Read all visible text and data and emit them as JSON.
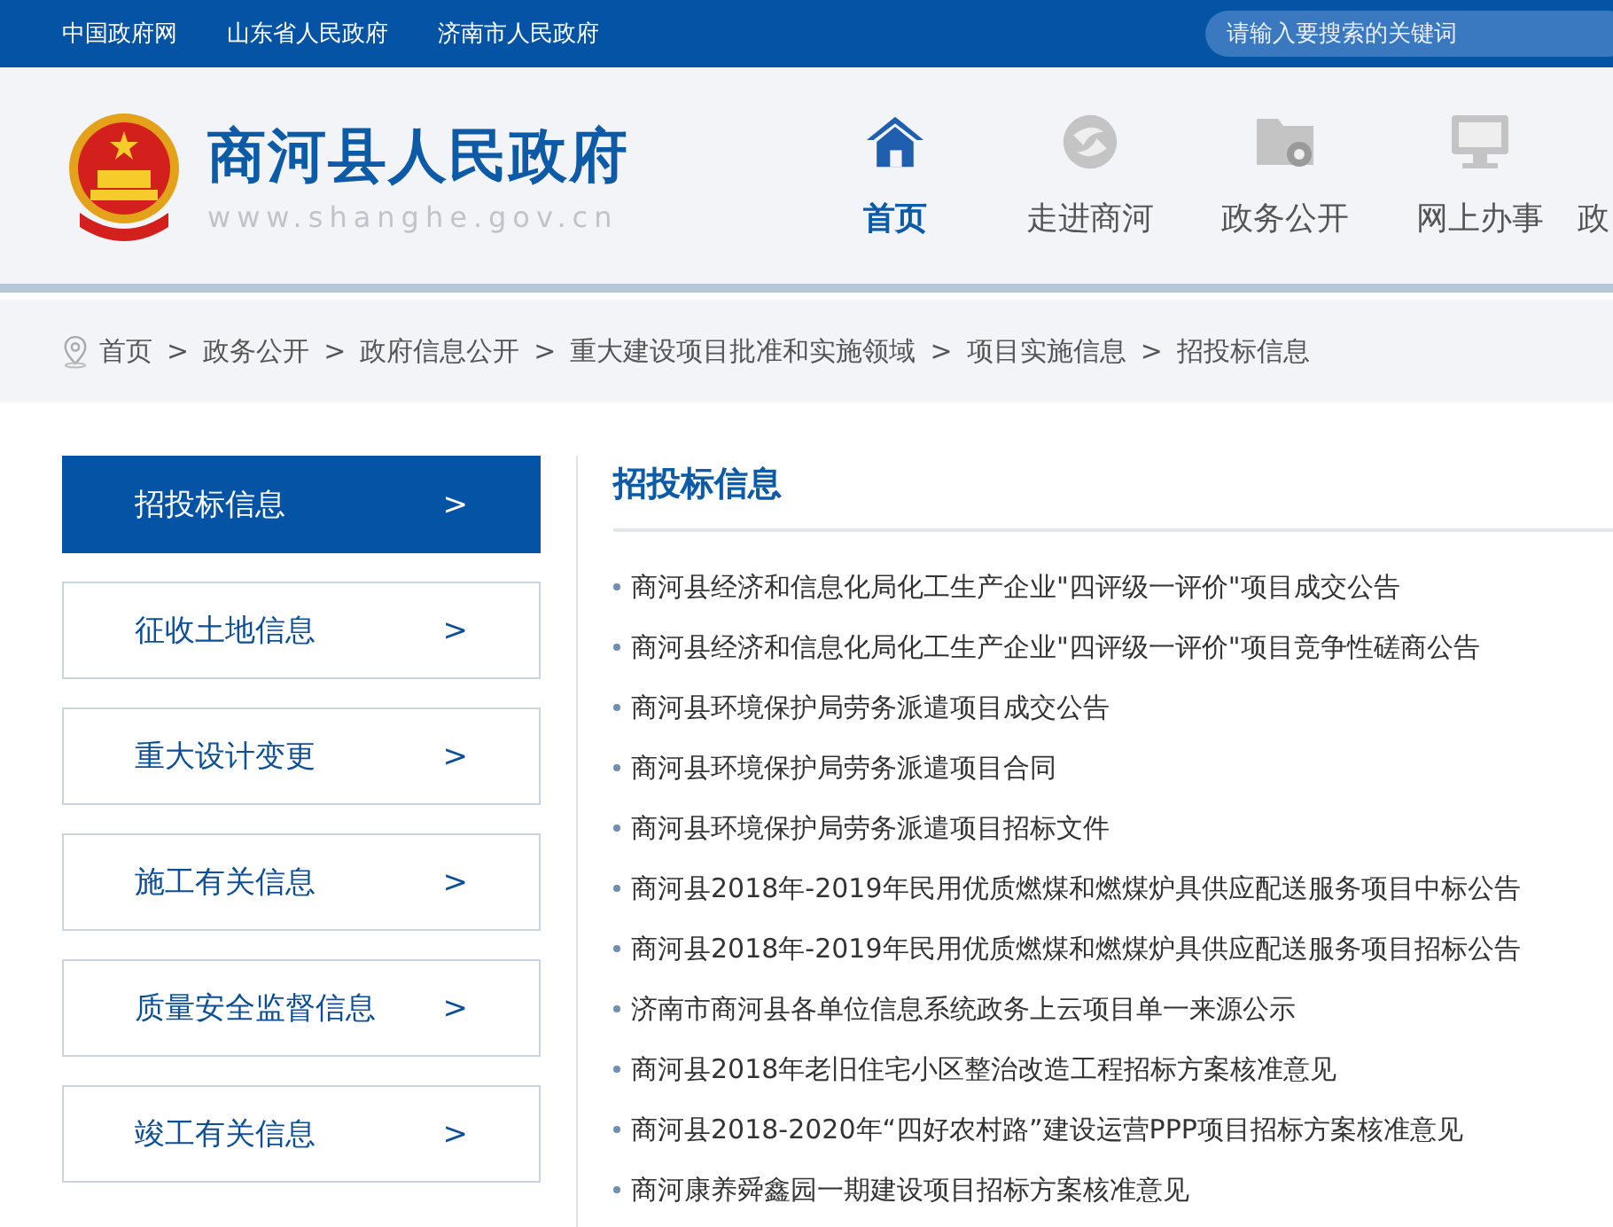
{
  "top_links": [
    "中国政府网",
    "山东省人民政府",
    "济南市人民政府"
  ],
  "search": {
    "placeholder": "请输入要搜索的关键词"
  },
  "site": {
    "title": "商河县人民政府",
    "url": "www.shanghe.gov.cn"
  },
  "nav": [
    {
      "label": "首页",
      "kind": "home",
      "selected": true
    },
    {
      "label": "走进商河",
      "kind": "swirl",
      "selected": false
    },
    {
      "label": "政务公开",
      "kind": "folder",
      "selected": false
    },
    {
      "label": "网上办事",
      "kind": "monitor",
      "selected": false
    },
    {
      "label": "政",
      "kind": "cut",
      "selected": false
    }
  ],
  "breadcrumb": [
    "首页",
    "政务公开",
    "政府信息公开",
    "重大建设项目批准和实施领域",
    "项目实施信息",
    "招投标信息"
  ],
  "sidebar": [
    {
      "label": "招投标信息",
      "selected": true
    },
    {
      "label": "征收土地信息",
      "selected": false
    },
    {
      "label": "重大设计变更",
      "selected": false
    },
    {
      "label": "施工有关信息",
      "selected": false
    },
    {
      "label": "质量安全监督信息",
      "selected": false
    },
    {
      "label": "竣工有关信息",
      "selected": false
    }
  ],
  "sidebar_arrow": ">",
  "breadcrumb_sep": ">",
  "section_title": "招投标信息",
  "items": [
    "商河县经济和信息化局化工生产企业\"四评级一评价\"项目成交公告",
    "商河县经济和信息化局化工生产企业\"四评级一评价\"项目竞争性磋商公告",
    "商河县环境保护局劳务派遣项目成交公告",
    "商河县环境保护局劳务派遣项目合同",
    "商河县环境保护局劳务派遣项目招标文件",
    "商河县2018年-2019年民用优质燃煤和燃煤炉具供应配送服务项目中标公告",
    "商河县2018年-2019年民用优质燃煤和燃煤炉具供应配送服务项目招标公告",
    "济南市商河县各单位信息系统政务上云项目单一来源公示",
    "商河县2018年老旧住宅小区整治改造工程招标方案核准意见",
    "商河县2018-2020年“四好农村路”建设运营PPP项目招标方案核准意见",
    "商河康养舜鑫园一期建设项目招标方案核准意见"
  ]
}
